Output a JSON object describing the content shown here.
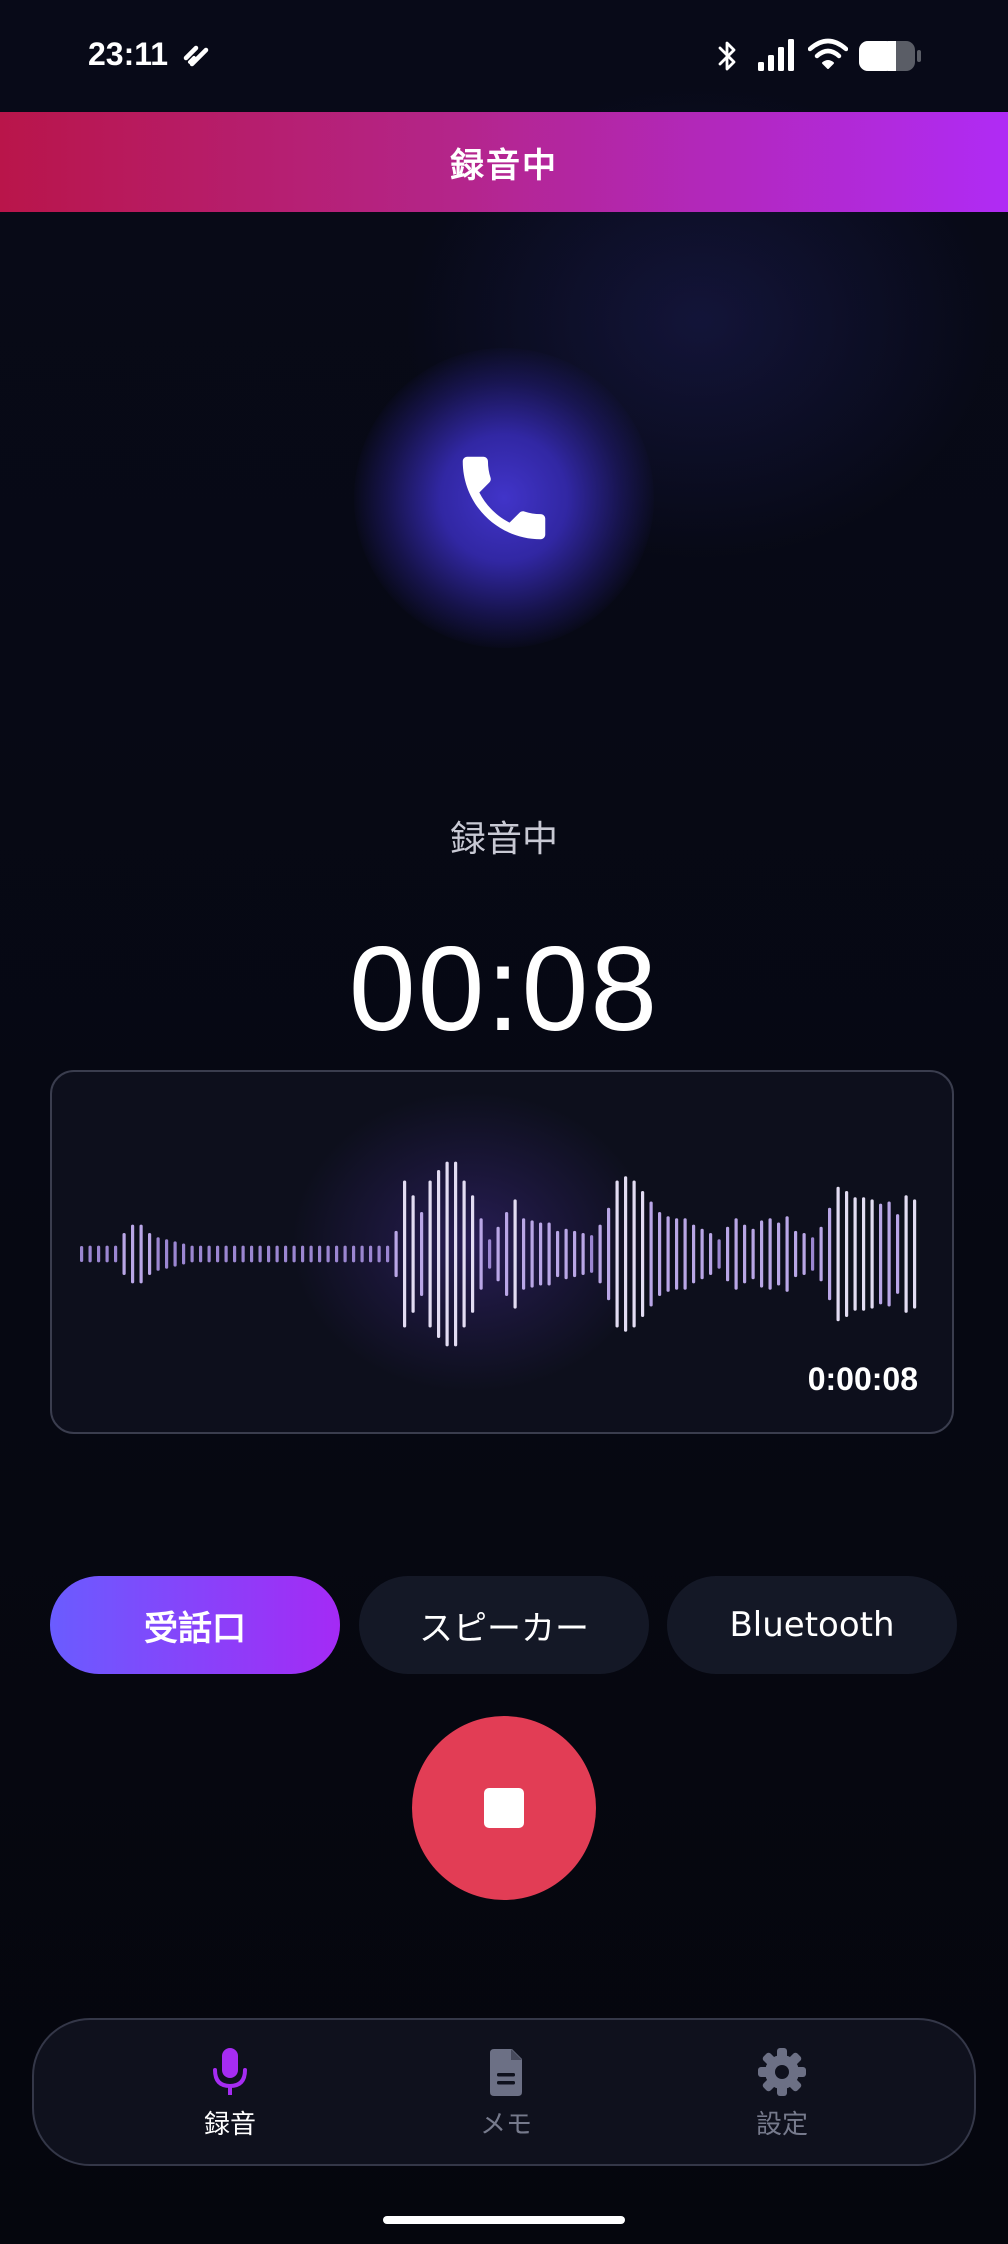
{
  "status_bar": {
    "time": "23:11",
    "icons": [
      "link-icon",
      "bluetooth-icon",
      "signal-icon",
      "wifi-icon",
      "battery-icon"
    ]
  },
  "header": {
    "title": "録音中"
  },
  "call": {
    "icon": "phone-icon",
    "status": "録音中",
    "elapsed": "00:08"
  },
  "waveform": {
    "time": "0:00:08"
  },
  "audio_routes": [
    {
      "label": "受話口",
      "active": true
    },
    {
      "label": "スピーカー",
      "active": false
    },
    {
      "label": "Bluetooth",
      "active": false
    }
  ],
  "stop_button": {
    "icon": "stop-icon"
  },
  "nav": [
    {
      "label": "録音",
      "icon": "mic-icon",
      "active": true
    },
    {
      "label": "メモ",
      "icon": "document-icon",
      "active": false
    },
    {
      "label": "設定",
      "icon": "gear-icon",
      "active": false
    }
  ],
  "colors": {
    "accent": "#a42af5",
    "header_start": "#b9154a",
    "stop": "#e23d55",
    "background": "#070913"
  }
}
